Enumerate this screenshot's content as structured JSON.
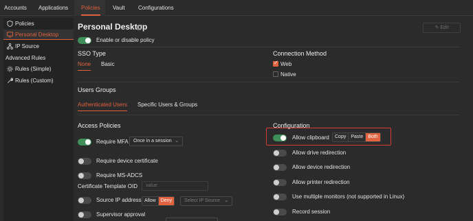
{
  "topnav": {
    "tabs": [
      {
        "label": "Accounts"
      },
      {
        "label": "Applications"
      },
      {
        "label": "Policies"
      },
      {
        "label": "Vault"
      },
      {
        "label": "Configurations"
      }
    ],
    "active": "Policies"
  },
  "sidebar": {
    "items": [
      {
        "label": "Policies",
        "icon": "shield-icon"
      },
      {
        "label": "Personal Desktop",
        "icon": "monitor-icon"
      },
      {
        "label": "IP Source",
        "icon": "network-icon"
      }
    ],
    "section": "Advanced Rules",
    "rules": [
      {
        "label": "Rules (Simple)",
        "icon": "gear-icon"
      },
      {
        "label": "Rules (Custom)",
        "icon": "wrench-icon"
      }
    ]
  },
  "main": {
    "title": "Personal Desktop",
    "title_icon": "copy-icon",
    "edit_label": "Edit",
    "enable_label": "Enable or disable policy",
    "sso": {
      "heading": "SSO Type",
      "options": [
        "None",
        "Basic"
      ],
      "selected": "None"
    },
    "connection": {
      "heading": "Connection Method",
      "web": "Web",
      "native": "Native",
      "web_checked": true,
      "native_checked": false
    },
    "users_groups": {
      "heading": "Users Groups",
      "tabs": [
        "Authenticated Users",
        "Specific Users & Groups"
      ],
      "active": "Authenticated Users"
    },
    "access": {
      "heading": "Access Policies",
      "require_mfa": "Require MFA",
      "mfa_select": "Once in a session",
      "require_cert": "Require device certificate",
      "require_adcs": "Require MS-ADCS",
      "cert_oid": "Certificate Template OID",
      "cert_oid_placeholder": "value",
      "source_ip": "Source IP address",
      "allow": "Allow",
      "deny": "Deny",
      "ip_select": "Select IP Source",
      "supervisor": "Supervisor approval"
    },
    "configuration": {
      "heading": "Configuration",
      "clipboard": "Allow clipboard",
      "clipboard_options": [
        "Copy",
        "Paste",
        "Both"
      ],
      "clipboard_selected": "Both",
      "drive": "Allow drive redirection",
      "device": "Allow device redirection",
      "printer": "Allow printer redirection",
      "monitors": "Use multiple monitors (not supported in Linux)",
      "record": "Record session"
    }
  },
  "colors": {
    "accent": "#e0623f",
    "toggle_on": "#3f8f5a",
    "highlight": "#d93a3a"
  }
}
